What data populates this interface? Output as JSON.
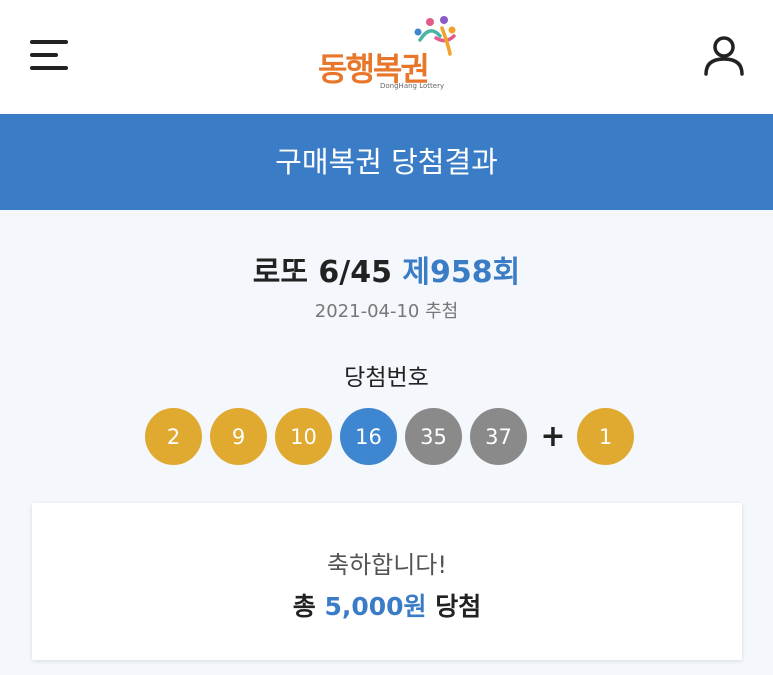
{
  "header": {
    "logo_text": "동행복권",
    "logo_subtext": "DongHang Lottery"
  },
  "banner": {
    "title": "구매복권 당첨결과"
  },
  "draw": {
    "game_name": "로또 6/45",
    "round": "제958회",
    "date": "2021-04-10 추첨",
    "numbers_label": "당첨번호",
    "numbers": [
      "2",
      "9",
      "10",
      "16",
      "35",
      "37"
    ],
    "plus": "+",
    "bonus": "1"
  },
  "result": {
    "message": "축하합니다!",
    "prize_prefix": "총",
    "prize_amount": "5,000원",
    "prize_suffix": "당첨"
  },
  "colors": {
    "brand_blue": "#3a7cc6",
    "ball_gold": "#e0a92f",
    "ball_blue": "#3e86d0",
    "ball_gray": "#8a8a8a",
    "logo_orange": "#e8762b"
  },
  "icons": {
    "menu": "hamburger-icon",
    "user": "user-icon"
  }
}
